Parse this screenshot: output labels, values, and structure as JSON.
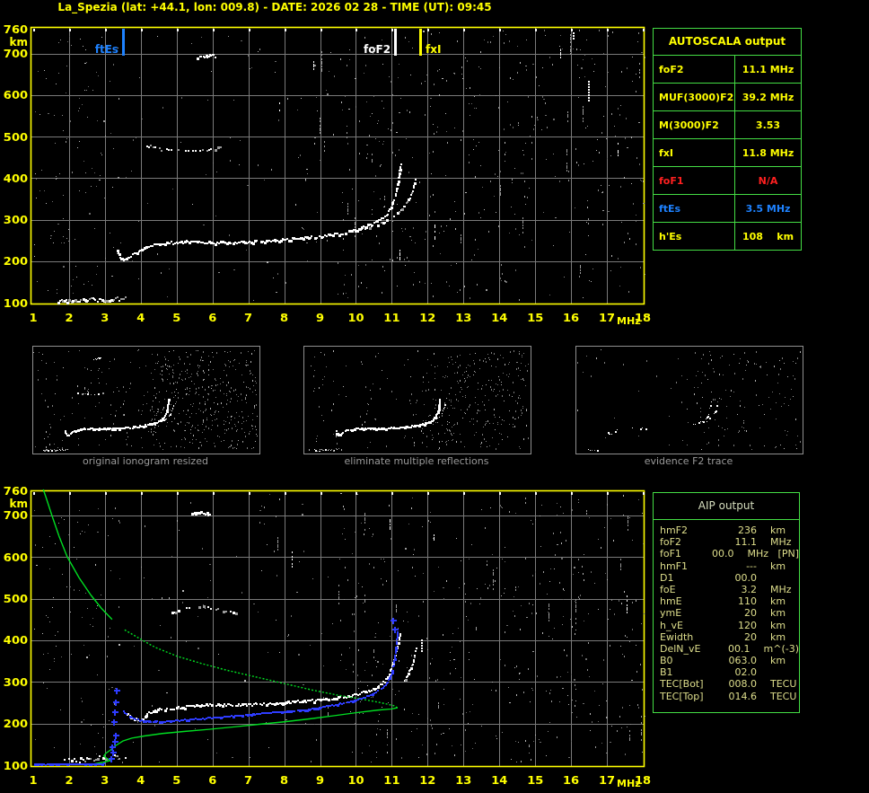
{
  "title": "La_Spezia (lat: +44.1, lon: 009.8) - DATE: 2026 02 28 - TIME (UT): 09:45",
  "colors": {
    "accent_yellow": "#ffff00",
    "grid": "#7a7a7a",
    "table_border": "#44dd44",
    "marker_blue": "#1e82ff",
    "trace_blue": "#2e3cff",
    "profile_green": "#00dd22",
    "status_red": "#ff2020"
  },
  "top_chart": {
    "type": "scatter",
    "title": "ionogram with autoscaled characteristics",
    "x_unit": "MHz",
    "y_unit": "km",
    "x_ticks": [
      1,
      2,
      3,
      4,
      5,
      6,
      7,
      8,
      9,
      10,
      11,
      12,
      13,
      14,
      15,
      16,
      17,
      18
    ],
    "y_ticks": [
      760,
      700,
      600,
      500,
      400,
      300,
      200,
      100
    ],
    "xlim": [
      1,
      18
    ],
    "ylim": [
      100,
      760
    ],
    "markers": [
      {
        "name": "ftEs",
        "freq": 3.5,
        "color": "#1e82ff",
        "label_side": "left"
      },
      {
        "name": "foF2",
        "freq": 11.1,
        "color": "#ffffff",
        "label_side": "left"
      },
      {
        "name": "fxI",
        "freq": 11.8,
        "color": "#ffff00",
        "label_side": "right"
      }
    ],
    "traces": {
      "es_layer": [
        [
          1.68,
          106
        ],
        [
          2.1,
          107
        ],
        [
          2.5,
          108
        ],
        [
          2.9,
          109
        ],
        [
          3.2,
          110
        ],
        [
          3.55,
          112
        ]
      ],
      "f_ordinary": [
        [
          3.32,
          230
        ],
        [
          3.4,
          212
        ],
        [
          3.5,
          204
        ],
        [
          3.62,
          210
        ],
        [
          3.8,
          220
        ],
        [
          4.0,
          230
        ],
        [
          4.3,
          240
        ],
        [
          4.7,
          245
        ],
        [
          5.2,
          248
        ],
        [
          5.7,
          248
        ],
        [
          6.2,
          246
        ],
        [
          6.7,
          247
        ],
        [
          7.2,
          249
        ],
        [
          7.7,
          252
        ],
        [
          8.2,
          255
        ],
        [
          8.7,
          259
        ],
        [
          9.2,
          264
        ],
        [
          9.7,
          271
        ],
        [
          10.1,
          280
        ],
        [
          10.4,
          290
        ],
        [
          10.7,
          303
        ],
        [
          10.9,
          320
        ],
        [
          11.0,
          340
        ],
        [
          11.1,
          365
        ],
        [
          11.16,
          392
        ],
        [
          11.2,
          418
        ],
        [
          11.23,
          435
        ]
      ],
      "f_extraordinary": [
        [
          9.9,
          272
        ],
        [
          10.3,
          281
        ],
        [
          10.7,
          293
        ],
        [
          11.0,
          306
        ],
        [
          11.2,
          320
        ],
        [
          11.35,
          336
        ],
        [
          11.48,
          356
        ],
        [
          11.58,
          378
        ],
        [
          11.64,
          398
        ]
      ],
      "second_hop": [
        [
          4.15,
          480
        ],
        [
          4.5,
          472
        ],
        [
          4.9,
          468
        ],
        [
          5.3,
          466
        ],
        [
          5.7,
          468
        ],
        [
          6.0,
          472
        ],
        [
          6.2,
          477
        ]
      ],
      "high_cluster": [
        [
          5.55,
          692
        ],
        [
          5.8,
          696
        ],
        [
          6.05,
          697
        ]
      ],
      "streaks": [
        {
          "f": 16.47,
          "h1": 588,
          "h2": 634
        },
        {
          "f": 16.05,
          "h1": 738,
          "h2": 752
        }
      ]
    }
  },
  "thumbnails": [
    {
      "caption": "original ionogram resized"
    },
    {
      "caption": "eliminate multiple reflections"
    },
    {
      "caption": "evidence F2 trace"
    }
  ],
  "bottom_chart": {
    "type": "scatter",
    "title": "ionogram with restored trace and electron density profile",
    "x_unit": "MHz",
    "y_unit": "km",
    "x_ticks": [
      1,
      2,
      3,
      4,
      5,
      6,
      7,
      8,
      9,
      10,
      11,
      12,
      13,
      14,
      15,
      16,
      17,
      18
    ],
    "y_ticks": [
      760,
      700,
      600,
      500,
      400,
      300,
      200,
      100
    ],
    "xlim": [
      1,
      18
    ],
    "ylim": [
      100,
      760
    ],
    "traces": {
      "es_layer": [
        [
          1.85,
          112
        ],
        [
          2.2,
          114
        ],
        [
          2.6,
          117
        ],
        [
          2.95,
          120
        ],
        [
          3.25,
          123
        ],
        [
          3.55,
          121
        ]
      ],
      "f_ordinary": [
        [
          3.6,
          226
        ],
        [
          3.75,
          214
        ],
        [
          3.95,
          208
        ],
        [
          4.2,
          226
        ],
        [
          4.5,
          235
        ],
        [
          4.9,
          238
        ],
        [
          5.4,
          243
        ],
        [
          5.9,
          247
        ],
        [
          6.4,
          246
        ],
        [
          6.9,
          247
        ],
        [
          7.4,
          249
        ],
        [
          7.9,
          251
        ],
        [
          8.4,
          254
        ],
        [
          8.9,
          257
        ],
        [
          9.4,
          262
        ],
        [
          9.9,
          269
        ],
        [
          10.2,
          276
        ],
        [
          10.5,
          286
        ],
        [
          10.75,
          300
        ],
        [
          10.9,
          318
        ],
        [
          11.0,
          342
        ],
        [
          11.1,
          370
        ],
        [
          11.17,
          398
        ],
        [
          11.22,
          420
        ]
      ],
      "f_extraordinary": [
        [
          11.28,
          292
        ],
        [
          11.4,
          312
        ],
        [
          11.5,
          332
        ],
        [
          11.6,
          356
        ],
        [
          11.66,
          382
        ]
      ],
      "second_hop": [
        [
          4.85,
          468
        ],
        [
          5.2,
          476
        ],
        [
          5.6,
          481
        ],
        [
          6.0,
          478
        ],
        [
          6.35,
          472
        ],
        [
          6.7,
          466
        ]
      ],
      "high_cluster": [
        [
          5.4,
          706
        ],
        [
          5.65,
          708
        ],
        [
          5.9,
          704
        ]
      ],
      "streaks": [
        {
          "f": 11.82,
          "h1": 374,
          "h2": 402
        }
      ]
    },
    "restored_trace_blue": {
      "es_flat": [
        [
          1.02,
          104
        ],
        [
          1.5,
          104
        ],
        [
          2.0,
          104
        ],
        [
          2.5,
          104
        ],
        [
          2.95,
          105
        ]
      ],
      "f_trace": [
        [
          3.5,
          232
        ],
        [
          3.62,
          222
        ],
        [
          3.78,
          214
        ],
        [
          3.95,
          210
        ],
        [
          4.15,
          207
        ],
        [
          4.5,
          206
        ],
        [
          4.9,
          208
        ],
        [
          5.3,
          211
        ],
        [
          5.8,
          214
        ],
        [
          6.3,
          218
        ],
        [
          6.8,
          221
        ],
        [
          7.3,
          225
        ],
        [
          7.8,
          229
        ],
        [
          8.3,
          233
        ],
        [
          8.8,
          238
        ],
        [
          9.3,
          245
        ],
        [
          9.8,
          254
        ],
        [
          10.15,
          262
        ],
        [
          10.45,
          272
        ],
        [
          10.7,
          284
        ],
        [
          10.85,
          298
        ],
        [
          10.95,
          315
        ],
        [
          11.02,
          338
        ],
        [
          11.07,
          362
        ],
        [
          11.1,
          385
        ],
        [
          11.13,
          408
        ],
        [
          11.15,
          422
        ]
      ],
      "plus_marks": [
        [
          3.18,
          116
        ],
        [
          3.24,
          130
        ],
        [
          3.2,
          143
        ],
        [
          3.27,
          156
        ],
        [
          3.3,
          172
        ],
        [
          3.25,
          203
        ],
        [
          3.29,
          228
        ],
        [
          3.31,
          252
        ],
        [
          3.33,
          280
        ],
        [
          11.08,
          425
        ],
        [
          11.04,
          448
        ]
      ]
    },
    "profile_green": {
      "bottomside": [
        [
          2.45,
          100
        ],
        [
          2.7,
          103
        ],
        [
          2.95,
          107
        ],
        [
          3.15,
          111
        ],
        [
          3.05,
          116
        ],
        [
          2.97,
          122
        ],
        [
          3.02,
          128
        ],
        [
          3.15,
          136
        ],
        [
          3.3,
          147
        ],
        [
          3.5,
          158
        ],
        [
          3.75,
          165
        ],
        [
          4.1,
          170
        ],
        [
          4.6,
          176
        ],
        [
          5.2,
          181
        ],
        [
          5.9,
          186
        ],
        [
          6.6,
          192
        ],
        [
          7.3,
          198
        ],
        [
          8.0,
          204
        ],
        [
          8.7,
          211
        ],
        [
          9.4,
          219
        ],
        [
          10.0,
          226
        ],
        [
          10.6,
          232
        ],
        [
          11.0,
          235
        ],
        [
          11.16,
          238
        ]
      ],
      "topside": [
        [
          11.16,
          238
        ],
        [
          11.05,
          243
        ],
        [
          10.7,
          250
        ],
        [
          10.2,
          258
        ],
        [
          9.5,
          268
        ],
        [
          8.8,
          280
        ],
        [
          8.0,
          296
        ],
        [
          7.2,
          312
        ],
        [
          6.4,
          328
        ],
        [
          5.7,
          344
        ],
        [
          5.0,
          362
        ],
        [
          4.4,
          383
        ],
        [
          4.05,
          400
        ],
        [
          3.55,
          425
        ],
        [
          3.2,
          450
        ],
        [
          2.9,
          477
        ],
        [
          2.62,
          507
        ],
        [
          2.28,
          550
        ],
        [
          1.95,
          600
        ],
        [
          1.72,
          650
        ],
        [
          1.52,
          700
        ],
        [
          1.35,
          745
        ],
        [
          1.28,
          762
        ]
      ]
    }
  },
  "autoscala": {
    "title": "AUTOSCALA output",
    "rows": [
      {
        "label": "foF2",
        "value": "11.1 MHz",
        "color": "yellow"
      },
      {
        "label": "MUF(3000)F2",
        "value": "39.2 MHz",
        "color": "yellow"
      },
      {
        "label": "M(3000)F2",
        "value": "3.53",
        "color": "yellow"
      },
      {
        "label": "fxI",
        "value": "11.8 MHz",
        "color": "yellow"
      },
      {
        "label": "foF1",
        "value": "N/A",
        "color": "red"
      },
      {
        "label": "ftEs",
        "value": "3.5 MHz",
        "color": "blue"
      },
      {
        "label": "h'Es",
        "value": "108    km",
        "color": "yellow"
      }
    ]
  },
  "aip": {
    "title": "AIP output",
    "rows": [
      {
        "label": "hmF2",
        "value": "236",
        "unit": "km"
      },
      {
        "label": "foF2",
        "value": "11.1",
        "unit": "MHz"
      },
      {
        "label": "foF1",
        "value": "00.0",
        "unit": "MHz   [PN]"
      },
      {
        "label": "hmF1",
        "value": "---",
        "unit": "km"
      },
      {
        "label": "D1",
        "value": "00.0",
        "unit": ""
      },
      {
        "label": "foE",
        "value": "3.2",
        "unit": "MHz"
      },
      {
        "label": "hmE",
        "value": "110",
        "unit": "km"
      },
      {
        "label": "ymE",
        "value": "20",
        "unit": "km"
      },
      {
        "label": "h_vE",
        "value": "120",
        "unit": "km"
      },
      {
        "label": "Ewidth",
        "value": "20",
        "unit": "km"
      },
      {
        "label": "DelN_vE",
        "value": "00.1",
        "unit": "m^(-3)"
      },
      {
        "label": "B0",
        "value": "063.0",
        "unit": "km"
      },
      {
        "label": "B1",
        "value": "02.0",
        "unit": ""
      },
      {
        "label": "TEC[Bot]",
        "value": "008.0",
        "unit": "TECU"
      },
      {
        "label": "TEC[Top]",
        "value": "014.6",
        "unit": "TECU"
      }
    ]
  }
}
